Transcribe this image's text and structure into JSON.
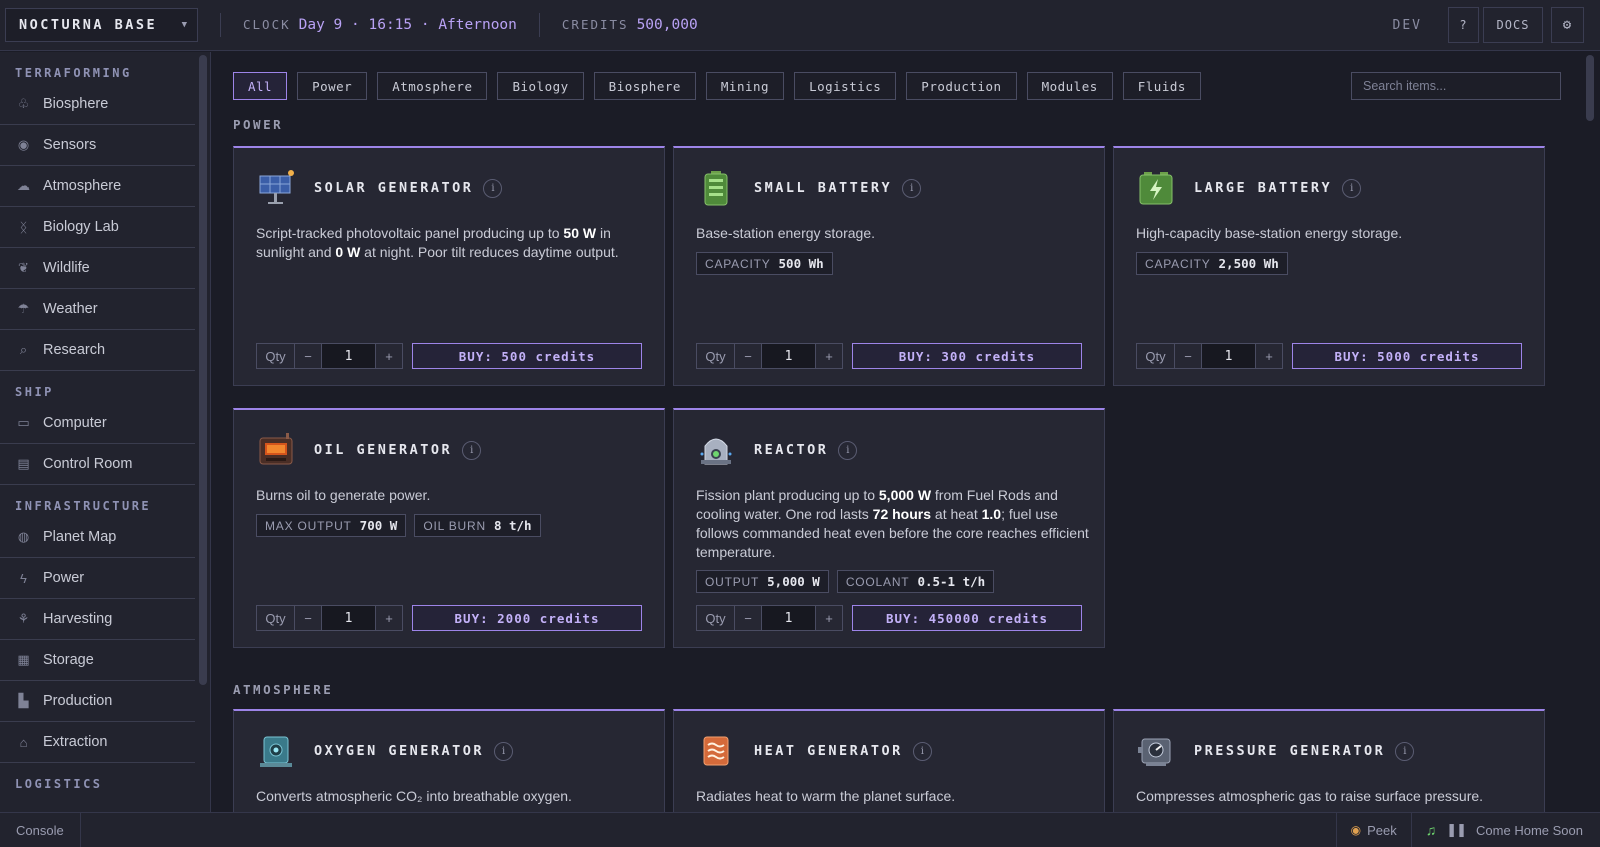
{
  "topbar": {
    "base_name": "NOCTURNA BASE",
    "clock_label": "CLOCK",
    "clock_value": "Day 9 · 16:15 · Afternoon",
    "credits_label": "CREDITS",
    "credits_value": "500,000",
    "dev_label": "DEV",
    "help_label": "?",
    "docs_label": "DOCS",
    "settings_label": "⚙"
  },
  "sidebar": {
    "sections": [
      {
        "title": "TERRAFORMING",
        "items": [
          {
            "label": "Biosphere",
            "icon": "leaf-icon",
            "glyph": "♧"
          },
          {
            "label": "Sensors",
            "icon": "sensor-icon",
            "glyph": "◉"
          },
          {
            "label": "Atmosphere",
            "icon": "cloud-icon",
            "glyph": "☁"
          },
          {
            "label": "Biology Lab",
            "icon": "dna-icon",
            "glyph": "ᛝ"
          },
          {
            "label": "Wildlife",
            "icon": "paw-icon",
            "glyph": "❦"
          },
          {
            "label": "Weather",
            "icon": "weather-icon",
            "glyph": "☂"
          },
          {
            "label": "Research",
            "icon": "search-icon",
            "glyph": "⌕"
          }
        ]
      },
      {
        "title": "SHIP",
        "items": [
          {
            "label": "Computer",
            "icon": "monitor-icon",
            "glyph": "▭"
          },
          {
            "label": "Control Room",
            "icon": "dashboard-icon",
            "glyph": "▤"
          }
        ]
      },
      {
        "title": "INFRASTRUCTURE",
        "items": [
          {
            "label": "Planet Map",
            "icon": "globe-icon",
            "glyph": "◍"
          },
          {
            "label": "Power",
            "icon": "bolt-icon",
            "glyph": "ϟ"
          },
          {
            "label": "Harvesting",
            "icon": "harvest-icon",
            "glyph": "⚘"
          },
          {
            "label": "Storage",
            "icon": "boxes-icon",
            "glyph": "▦"
          },
          {
            "label": "Production",
            "icon": "factory-icon",
            "glyph": "▙"
          },
          {
            "label": "Extraction",
            "icon": "drill-icon",
            "glyph": "⌂"
          }
        ]
      },
      {
        "title": "LOGISTICS",
        "items": []
      }
    ]
  },
  "filters": {
    "tabs": [
      "All",
      "Power",
      "Atmosphere",
      "Biology",
      "Biosphere",
      "Mining",
      "Logistics",
      "Production",
      "Modules",
      "Fluids"
    ],
    "active": "All",
    "search_placeholder": "Search items..."
  },
  "categories": {
    "power": "POWER",
    "atmosphere": "ATMOSPHERE"
  },
  "qty_label": "Qty",
  "qty_minus": "−",
  "qty_plus": "+",
  "info_glyph": "i",
  "cards": {
    "solar": {
      "title": "SOLAR GENERATOR",
      "icon": "solar-panel-icon",
      "qty": "1",
      "buy": "BUY: 500 credits",
      "desc": [
        "Script-tracked photovoltaic panel producing up to ",
        "50 W",
        " in sunlight and ",
        "0 W",
        " at night. Poor tilt reduces daytime output."
      ],
      "specs": []
    },
    "small_battery": {
      "title": "SMALL BATTERY",
      "icon": "battery-icon",
      "qty": "1",
      "buy": "BUY: 300 credits",
      "desc": [
        "Base-station energy storage."
      ],
      "specs": [
        {
          "k": "CAPACITY",
          "v": "500 Wh"
        }
      ]
    },
    "large_battery": {
      "title": "LARGE BATTERY",
      "icon": "large-battery-icon",
      "qty": "1",
      "buy": "BUY: 5000 credits",
      "desc": [
        "High-capacity base-station energy storage."
      ],
      "specs": [
        {
          "k": "CAPACITY",
          "v": "2,500 Wh"
        }
      ]
    },
    "oil": {
      "title": "OIL GENERATOR",
      "icon": "oil-generator-icon",
      "qty": "1",
      "buy": "BUY: 2000 credits",
      "desc": [
        "Burns oil to generate power."
      ],
      "specs": [
        {
          "k": "MAX OUTPUT",
          "v": "700 W"
        },
        {
          "k": "OIL BURN",
          "v": "8 t/h"
        }
      ]
    },
    "reactor": {
      "title": "REACTOR",
      "icon": "reactor-icon",
      "qty": "1",
      "buy": "BUY: 450000 credits",
      "desc": [
        "Fission plant producing up to ",
        "5,000 W",
        " from Fuel Rods and cooling water. One rod lasts ",
        "72 hours",
        " at heat ",
        "1.0",
        "; fuel use follows commanded heat even before the core reaches efficient temperature."
      ],
      "specs": [
        {
          "k": "OUTPUT",
          "v": "5,000 W"
        },
        {
          "k": "COOLANT",
          "v": "0.5-1 t/h"
        }
      ]
    },
    "oxygen": {
      "title": "OXYGEN GENERATOR",
      "icon": "oxygen-generator-icon",
      "desc": [
        "Converts atmospheric CO₂ into breathable oxygen."
      ]
    },
    "heat": {
      "title": "HEAT GENERATOR",
      "icon": "heater-icon",
      "desc": [
        "Radiates heat to warm the planet surface."
      ]
    },
    "pressure": {
      "title": "PRESSURE GENERATOR",
      "icon": "pressure-generator-icon",
      "desc": [
        "Compresses atmospheric gas to raise surface pressure."
      ]
    }
  },
  "bottombar": {
    "console_label": "Console",
    "peek_label": "Peek",
    "track_title": "Come Home Soon"
  },
  "colors": {
    "accent": "#9d84e8",
    "background": "#1b1c26",
    "panel": "#262733",
    "music_green": "#6fd66f"
  }
}
